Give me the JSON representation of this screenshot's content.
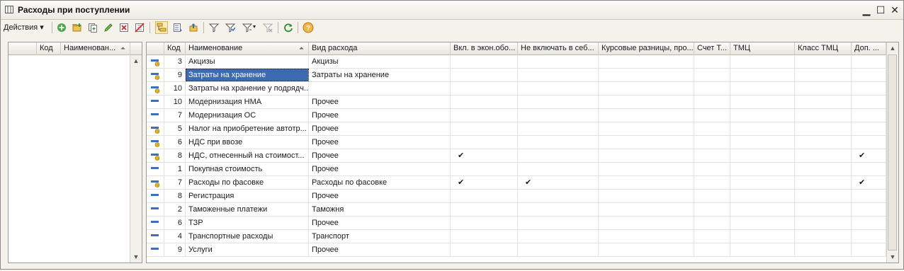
{
  "window": {
    "title": "Расходы при поступлении",
    "controls": {
      "minimize": "▁",
      "maximize": "☐",
      "close": "✕"
    }
  },
  "toolbar": {
    "actions_label": "Действия",
    "icons": [
      "add-icon",
      "add-folder-icon",
      "copy-icon",
      "edit-icon",
      "delete-icon",
      "mark-delete-icon",
      "hierarchy-icon",
      "tree-icon",
      "level-up-icon",
      "filter-icon",
      "filter-by-value-icon",
      "filter-history-icon",
      "clear-filter-icon",
      "refresh-icon",
      "help-icon"
    ]
  },
  "left_tree": {
    "columns": [
      "Код",
      "Наименован..."
    ]
  },
  "table": {
    "columns": [
      "Код",
      "Наименование",
      "Вид расхода",
      "Вкл. в экон.обо...",
      "Не включать в себ...",
      "Курсовые разницы, про...",
      "Счет Т...",
      "ТМЦ",
      "Класс ТМЦ",
      "Доп. ..."
    ],
    "check_mark": "✔",
    "rows": [
      {
        "code": "3",
        "name": "Акцизы",
        "type": "Акцизы",
        "econ": false,
        "noself": false,
        "dop": false,
        "icon": "item-yellow-icon"
      },
      {
        "code": "9",
        "name": "Затраты на хранение",
        "type": "Затраты на хранение",
        "econ": false,
        "noself": false,
        "dop": false,
        "icon": "item-yellow-icon",
        "selected": true
      },
      {
        "code": "10",
        "name": "Затраты на хранение у подрядч...",
        "type": "",
        "econ": false,
        "noself": false,
        "dop": false,
        "icon": "item-yellow-icon"
      },
      {
        "code": "10",
        "name": "Модернизация НМА",
        "type": "Прочее",
        "econ": false,
        "noself": false,
        "dop": false,
        "icon": "item-blue-icon"
      },
      {
        "code": "7",
        "name": "Модернизация ОС",
        "type": "Прочее",
        "econ": false,
        "noself": false,
        "dop": false,
        "icon": "item-blue-icon"
      },
      {
        "code": "5",
        "name": "Налог на приобретение автотр...",
        "type": "Прочее",
        "econ": false,
        "noself": false,
        "dop": false,
        "icon": "item-yellow-icon"
      },
      {
        "code": "6",
        "name": "НДС при ввозе",
        "type": "Прочее",
        "econ": false,
        "noself": false,
        "dop": false,
        "icon": "item-yellow-icon"
      },
      {
        "code": "8",
        "name": "НДС, отнесенный на стоимост...",
        "type": "Прочее",
        "econ": true,
        "noself": false,
        "dop": true,
        "icon": "item-yellow-icon"
      },
      {
        "code": "1",
        "name": "Покупная стоимость",
        "type": "Прочее",
        "econ": false,
        "noself": false,
        "dop": false,
        "icon": "item-blue-icon"
      },
      {
        "code": "7",
        "name": "Расходы по фасовке",
        "type": "Расходы по фасовке",
        "econ": true,
        "noself": true,
        "dop": true,
        "icon": "item-yellow-icon"
      },
      {
        "code": "8",
        "name": "Регистрация",
        "type": "Прочее",
        "econ": false,
        "noself": false,
        "dop": false,
        "icon": "item-blue-icon"
      },
      {
        "code": "2",
        "name": "Таможенные платежи",
        "type": "Таможня",
        "econ": false,
        "noself": false,
        "dop": false,
        "icon": "item-blue-icon"
      },
      {
        "code": "6",
        "name": "ТЗР",
        "type": "Прочее",
        "econ": false,
        "noself": false,
        "dop": false,
        "icon": "item-blue-icon"
      },
      {
        "code": "4",
        "name": "Транспортные расходы",
        "type": "Транспорт",
        "econ": false,
        "noself": false,
        "dop": false,
        "icon": "item-blue-icon"
      },
      {
        "code": "9",
        "name": "Услуги",
        "type": "Прочее",
        "econ": false,
        "noself": false,
        "dop": false,
        "icon": "item-blue-icon"
      }
    ]
  },
  "colors": {
    "selection": "#3d6bb3",
    "icon_blue": "#3a6fc2",
    "icon_yellow": "#e2b21c"
  }
}
